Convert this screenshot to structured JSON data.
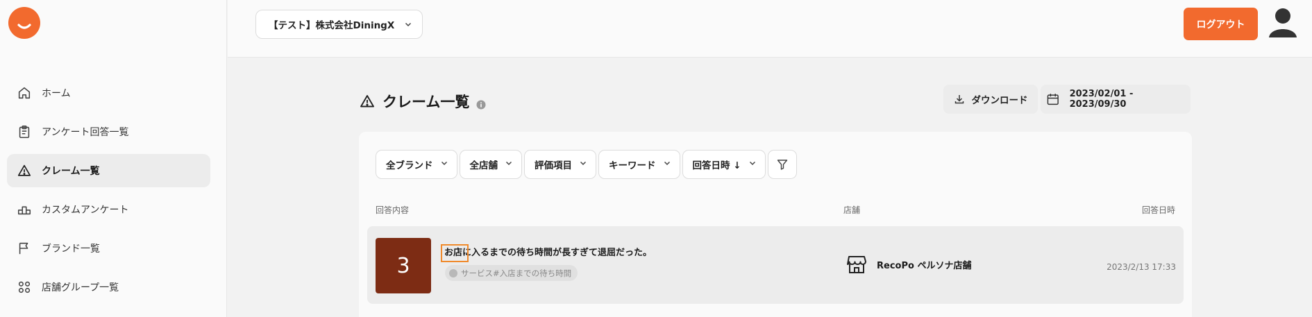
{
  "colors": {
    "accent": "#f26a2e",
    "score_bg": "#7d2c14",
    "highlight": "#f08a2c"
  },
  "sidebar": {
    "items": [
      {
        "label": "ホーム",
        "icon": "home-icon",
        "active": false
      },
      {
        "label": "アンケート回答一覧",
        "icon": "clipboard-icon",
        "active": false
      },
      {
        "label": "クレーム一覧",
        "icon": "warning-icon",
        "active": true
      },
      {
        "label": "カスタムアンケート",
        "icon": "podium-icon",
        "active": false
      },
      {
        "label": "ブランド一覧",
        "icon": "flag-icon",
        "active": false
      },
      {
        "label": "店舗グループ一覧",
        "icon": "grid-icon",
        "active": false
      }
    ]
  },
  "header": {
    "company": "【テスト】株式会社DiningX",
    "logout_label": "ログアウト"
  },
  "main": {
    "title": "クレーム一覧",
    "download_label": "ダウンロード",
    "date_range": "2023/02/01 - 2023/09/30",
    "filters": [
      "全ブランド",
      "全店舗",
      "評価項目",
      "キーワード",
      "回答日時 ↓"
    ],
    "columns": {
      "content": "回答内容",
      "store": "店舗",
      "datetime": "回答日時"
    },
    "rows": [
      {
        "score": "3",
        "comment": "お店に入るまでの待ち時間が長すぎて退屈だった。",
        "tag": "サービス#入店までの待ち時間",
        "store": "RecoPo ペルソナ店舗",
        "datetime": "2023/2/13 17:33"
      }
    ]
  }
}
